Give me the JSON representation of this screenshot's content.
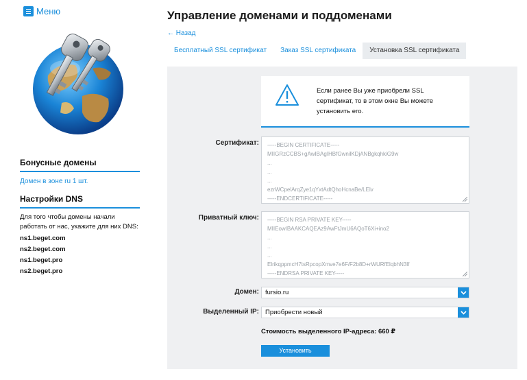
{
  "sidebar": {
    "menu_label": "Меню",
    "bonus_heading": "Бонусные домены",
    "bonus_link": "Домен в зоне ru 1 шт.",
    "dns_heading": "Настройки DNS",
    "dns_info": "Для того чтобы домены начали работать от нас, укажите для них DNS:",
    "dns_servers": [
      "ns1.beget.com",
      "ns2.beget.com",
      "ns1.beget.pro",
      "ns2.beget.pro"
    ]
  },
  "main": {
    "title": "Управление доменами и поддоменами",
    "back_link": "← Назад",
    "tabs": [
      {
        "label": "Бесплатный SSL сертификат",
        "active": false
      },
      {
        "label": "Заказ SSL сертификата",
        "active": false
      },
      {
        "label": "Установка SSL сертификата",
        "active": true
      }
    ],
    "notice": "Если ранее Вы уже приобрели SSL сертификат, то в этом окне Вы можете установить его.",
    "certificate": {
      "label": "Сертификат:",
      "lines": [
        "-----BEGIN CERTIFICATE-----",
        "MIIGRzCCBS+gAwIBAgIHBfGwnilKDjANBgkqhkiG9w",
        "...",
        "...",
        "...",
        "ezrWCpelArqZye1qYxtAdtQhoHcnaBe/LElv",
        "-----ENDCERTIFICATE-----"
      ]
    },
    "private_key": {
      "label": "Приватный ключ:",
      "lines": [
        "-----BEGIN RSA PRIVATE KEY-----",
        "MIIEowIBAAKCAQEAz9AwFtJmU6AQoT6Xi+ino2",
        "...",
        "...",
        "...",
        "ElrikqppmcH7tsRpcopXmve7e6F/F2b8D+rWURfElqbhN3lf",
        "-----ENDRSA PRIVATE KEY-----"
      ]
    },
    "domain": {
      "label": "Домен:",
      "value": "fursio.ru"
    },
    "ip": {
      "label": "Выделенный IP:",
      "value": "Приобрести новый"
    },
    "price": "Стоимость выделенного IP-адреса: 660 ₽",
    "install_button": "Установить"
  },
  "colors": {
    "accent": "#1a8fdc",
    "panel_bg": "#eff0f2"
  }
}
